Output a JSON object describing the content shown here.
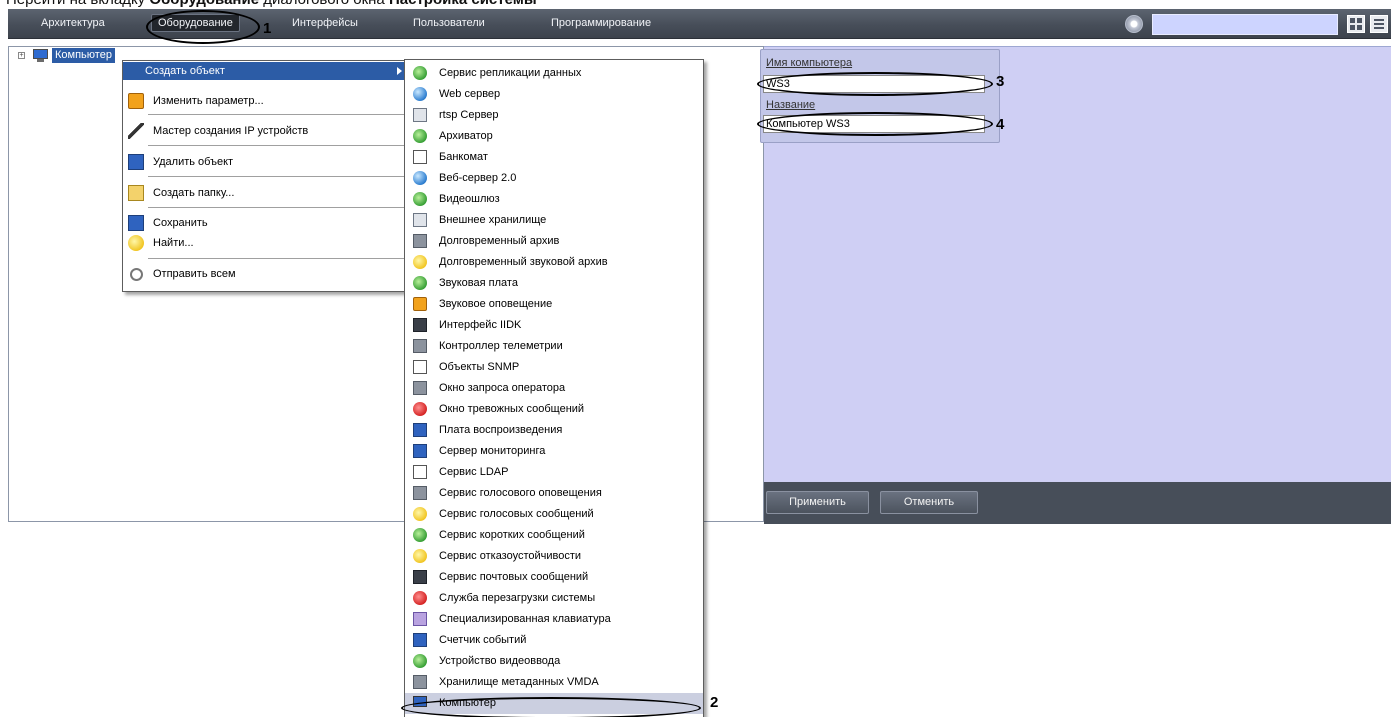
{
  "caption": {
    "prefix": "Перейти на вкладку ",
    "tab_bold": "Оборудование",
    "middle": " диалогового окна ",
    "window_bold": "Настройка системы"
  },
  "tabs": [
    "Архитектура",
    "Оборудование",
    "Интерфейсы",
    "Пользователи",
    "Программирование"
  ],
  "active_tab_index": 1,
  "tree": {
    "root_label": "Компьютер",
    "expander": "+"
  },
  "context_menu": {
    "items": [
      {
        "label": "Создать объект",
        "icon": "green-square-icon",
        "selected": true,
        "has_submenu": true
      },
      {
        "label": "Изменить параметр...",
        "icon": "pencil-icon"
      },
      {
        "label": "Мастер создания IP устройств",
        "icon": "wand-icon"
      },
      {
        "label": "Удалить объект",
        "icon": "delete-icon"
      },
      {
        "label": "Создать папку...",
        "icon": "new-folder-icon"
      },
      {
        "label": "Сохранить",
        "icon": "save-icon"
      },
      {
        "label": "Найти...",
        "icon": "find-icon"
      },
      {
        "label": "Отправить всем",
        "icon": "broadcast-icon"
      }
    ]
  },
  "submenu": {
    "items": [
      "Сервис репликации данных",
      "Web сервер",
      "rtsp Сервер",
      "Архиватор",
      "Банкомат",
      "Веб-сервер 2.0",
      "Видеошлюз",
      "Внешнее хранилище",
      "Долговременный архив",
      "Долговременный звуковой архив",
      "Звуковая плата",
      "Звуковое оповещение",
      "Интерфейс IIDK",
      "Контроллер телеметрии",
      "Объекты SNMP",
      "Окно запроса оператора",
      "Окно тревожных сообщений",
      "Плата воспроизведения",
      "Сервер мониторинга",
      "Сервис LDAP",
      "Сервис голосового оповещения",
      "Сервис голосовых сообщений",
      "Сервис коротких сообщений",
      "Сервис отказоустойчивости",
      "Сервис почтовых сообщений",
      "Служба перезагрузки системы",
      "Специализированная клавиатура",
      "Счетчик событий",
      "Устройство видеоввода",
      "Хранилище метаданных VMDA",
      "Компьютер"
    ],
    "highlighted_index": 30
  },
  "settings": {
    "computer_name_label": "Имя компьютера",
    "computer_name_value": "WS3",
    "name_label": "Название",
    "name_value": "Компьютер WS3",
    "apply_label": "Применить",
    "cancel_label": "Отменить"
  },
  "annotations": [
    "1",
    "2",
    "3",
    "4"
  ],
  "colors": {
    "topbar": "#474e59",
    "selection": "#2c5ca6",
    "settings_background": "#cfcff4",
    "search_box": "#cdd4ff"
  }
}
